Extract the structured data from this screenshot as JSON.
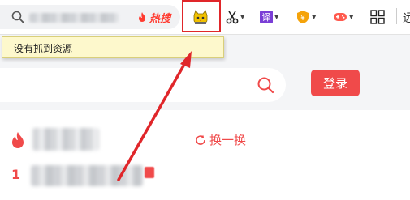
{
  "toolbar": {
    "hot_label": "热搜",
    "translate_label": "译",
    "yuan_label": "¥",
    "trailing_char": "远"
  },
  "tooltip": {
    "text": "没有抓到资源"
  },
  "search": {
    "login_label": "登录"
  },
  "hotlist": {
    "refresh_label": "换一换",
    "first_rank": "1"
  },
  "colors": {
    "accent_red": "#f04a4a",
    "annotation_red": "#e0262a",
    "tooltip_bg": "#fdf8cc"
  }
}
